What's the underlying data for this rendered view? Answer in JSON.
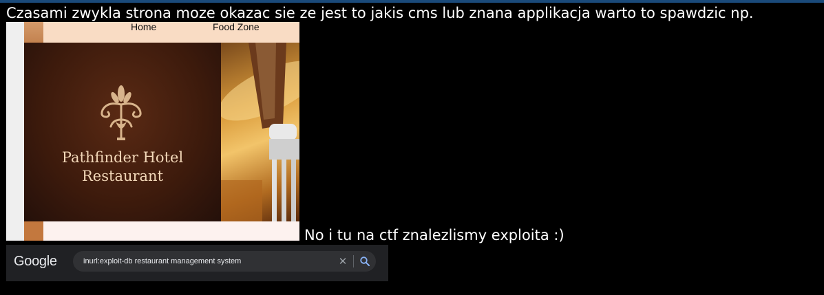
{
  "headline": "Czasami zwykla strona moze okazac sie ze jest to jakis cms lub znana applikacja warto to spawdzic np.",
  "restaurant_site": {
    "nav": {
      "home": "Home",
      "food_zone": "Food Zone"
    },
    "brand_line1": "Pathfinder Hotel",
    "brand_line2": "Restaurant"
  },
  "caption": "No i tu na ctf znalezlismy exploita :)",
  "google": {
    "logo": "Google",
    "query": "inurl:exploit-db restaurant management system",
    "clear_icon": "close-icon",
    "search_icon": "search-icon"
  },
  "colors": {
    "banner_brown": "#3c1a0c",
    "brand_text": "#f2d7b8",
    "google_bg": "#202124",
    "search_box": "#303134",
    "search_icon_blue": "#8ab4f8"
  }
}
